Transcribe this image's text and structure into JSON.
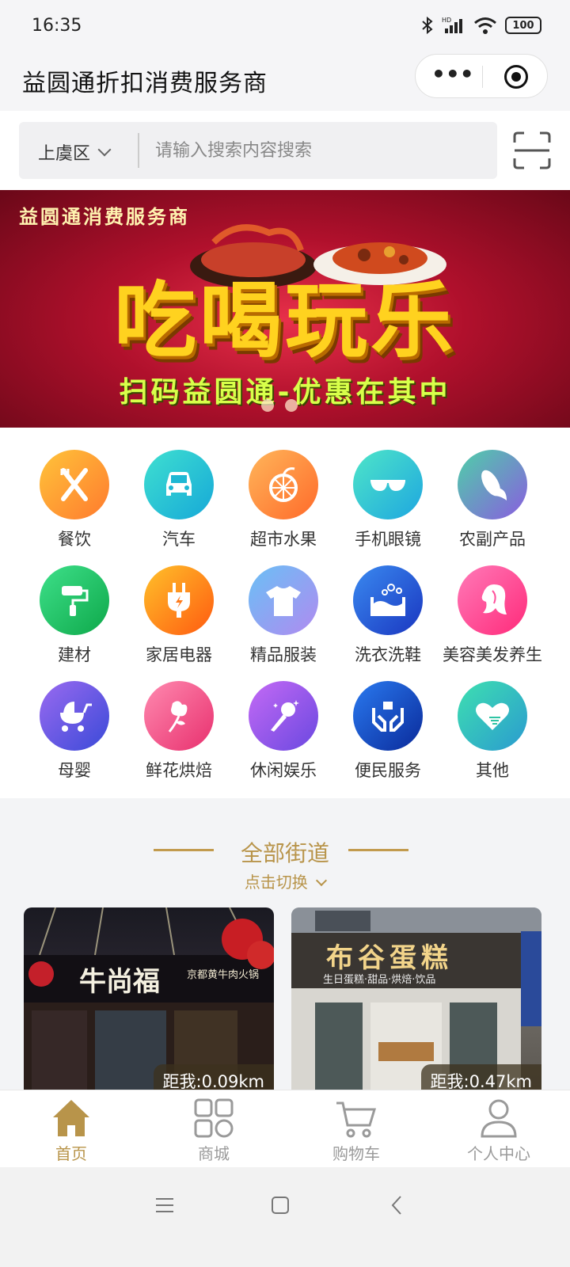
{
  "status_bar": {
    "time": "16:35",
    "battery": "100"
  },
  "title_bar": {
    "title": "益圆通折扣消费服务商"
  },
  "search": {
    "district": "上虞区",
    "placeholder": "请输入搜索内容搜索"
  },
  "banner": {
    "brand": "益圆通消费服务商",
    "headline": "吃喝玩乐",
    "slogan": "扫码益圆通-优惠在其中"
  },
  "categories": [
    {
      "label": "餐饮",
      "icon": "utensils-icon",
      "color": "#ff9a2e"
    },
    {
      "label": "汽车",
      "icon": "car-icon",
      "color": "#1fc7cf"
    },
    {
      "label": "超市水果",
      "icon": "orange-icon",
      "color": "#ff8a3c"
    },
    {
      "label": "手机眼镜",
      "icon": "glasses-icon",
      "color": "#2ec4d6"
    },
    {
      "label": "农副产品",
      "icon": "corn-icon",
      "color": "#7b6ad8"
    },
    {
      "label": "建材",
      "icon": "paint-roller-icon",
      "color": "#22b45a"
    },
    {
      "label": "家居电器",
      "icon": "plug-icon",
      "color": "#ff7a1a"
    },
    {
      "label": "精品服装",
      "icon": "tshirt-icon",
      "color": "#8c8cf0"
    },
    {
      "label": "洗衣洗鞋",
      "icon": "washing-icon",
      "color": "#2f5fe0"
    },
    {
      "label": "美容美发养生",
      "icon": "woman-hair-icon",
      "color": "#ff4f9a"
    },
    {
      "label": "母婴",
      "icon": "stroller-icon",
      "color": "#6a5ce8"
    },
    {
      "label": "鲜花烘焙",
      "icon": "flower-icon",
      "color": "#f24a8c"
    },
    {
      "label": "休闲娱乐",
      "icon": "microphone-icon",
      "color": "#9b5ef0"
    },
    {
      "label": "便民服务",
      "icon": "hands-box-icon",
      "color": "#1a4fc8"
    },
    {
      "label": "其他",
      "icon": "heart-hand-icon",
      "color": "#2fc4a4"
    }
  ],
  "street": {
    "title": "全部街道",
    "switch_label": "点击切换"
  },
  "stores": [
    {
      "sign": "牛尚福",
      "sub": "京都黄牛肉火锅",
      "distance": "距我:0.09km"
    },
    {
      "sign": "布谷蛋糕",
      "sub": "生日蛋糕·甜品·烘焙·饮品",
      "distance": "距我:0.47km"
    }
  ],
  "tabbar": [
    {
      "label": "首页",
      "icon": "home-icon",
      "active": true
    },
    {
      "label": "商城",
      "icon": "grid-icon",
      "active": false
    },
    {
      "label": "购物车",
      "icon": "cart-icon",
      "active": false
    },
    {
      "label": "个人中心",
      "icon": "user-icon",
      "active": false
    }
  ],
  "colors": {
    "accent": "#b8944a",
    "banner_red": "#b0102c"
  }
}
